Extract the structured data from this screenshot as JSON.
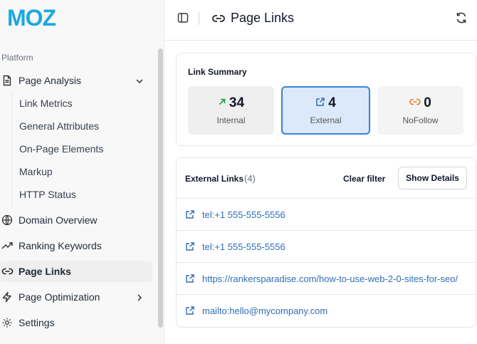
{
  "brand": {
    "logo_text": "MOZ",
    "logo_color": "#1ba8e0"
  },
  "sidebar": {
    "section_label": "Platform",
    "page_analysis": {
      "label": "Page Analysis",
      "icon": "document-icon"
    },
    "sub_items": [
      "Link Metrics",
      "General Attributes",
      "On-Page Elements",
      "Markup",
      "HTTP Status"
    ],
    "domain_overview": "Domain Overview",
    "ranking_keywords": "Ranking Keywords",
    "page_links": "Page Links",
    "page_optimization": "Page Optimization",
    "settings": "Settings"
  },
  "header": {
    "title": "Page Links"
  },
  "summary": {
    "title": "Link Summary",
    "internal": {
      "value": "34",
      "label": "Internal",
      "color": "#16a34a"
    },
    "external": {
      "value": "4",
      "label": "External",
      "color": "#2f6db5"
    },
    "nofollow": {
      "value": "0",
      "label": "NoFollow",
      "color": "#ea7a2a"
    }
  },
  "links": {
    "title": "External Links",
    "count": "(4)",
    "clear_filter": "Clear filter",
    "show_details": "Show Details",
    "items": [
      "tel:+1 555-555-5556",
      "tel:+1 555-555-5556",
      "https://rankersparadise.com/how-to-use-web-2-0-sites-for-seo/",
      "mailto:hello@mycompany.com"
    ]
  },
  "colors": {
    "accent": "#3b82d6",
    "link": "#2f6db5",
    "selected_bg": "#dbe9fb"
  }
}
